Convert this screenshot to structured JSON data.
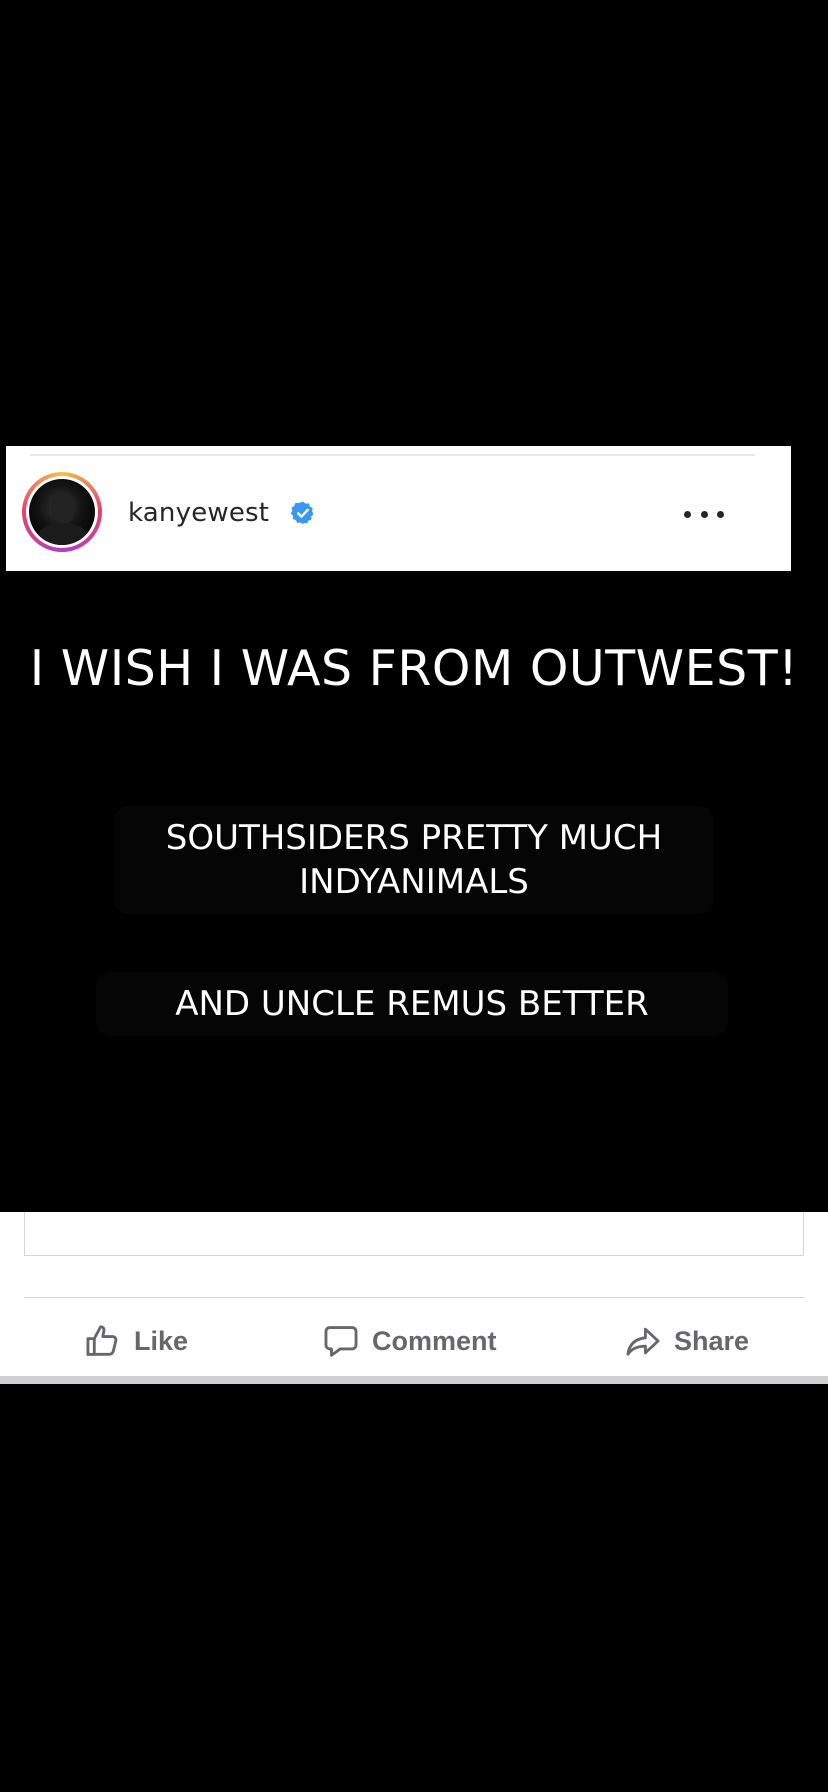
{
  "post": {
    "username": "kanyewest",
    "verified": true,
    "headline": "I WISH I WAS FROM OUTWEST!",
    "caption_1": "SOUTHSIDERS PRETTY MUCH INDYANIMALS",
    "caption_2": "AND UNCLE REMUS BETTER"
  },
  "actions": {
    "like_label": "Like",
    "comment_label": "Comment",
    "share_label": "Share"
  },
  "colors": {
    "background": "#000000",
    "verified_blue": "#3897f0",
    "action_gray": "#65676b"
  },
  "icons": [
    "verified-icon",
    "more-icon",
    "like-icon",
    "comment-icon",
    "share-icon"
  ]
}
